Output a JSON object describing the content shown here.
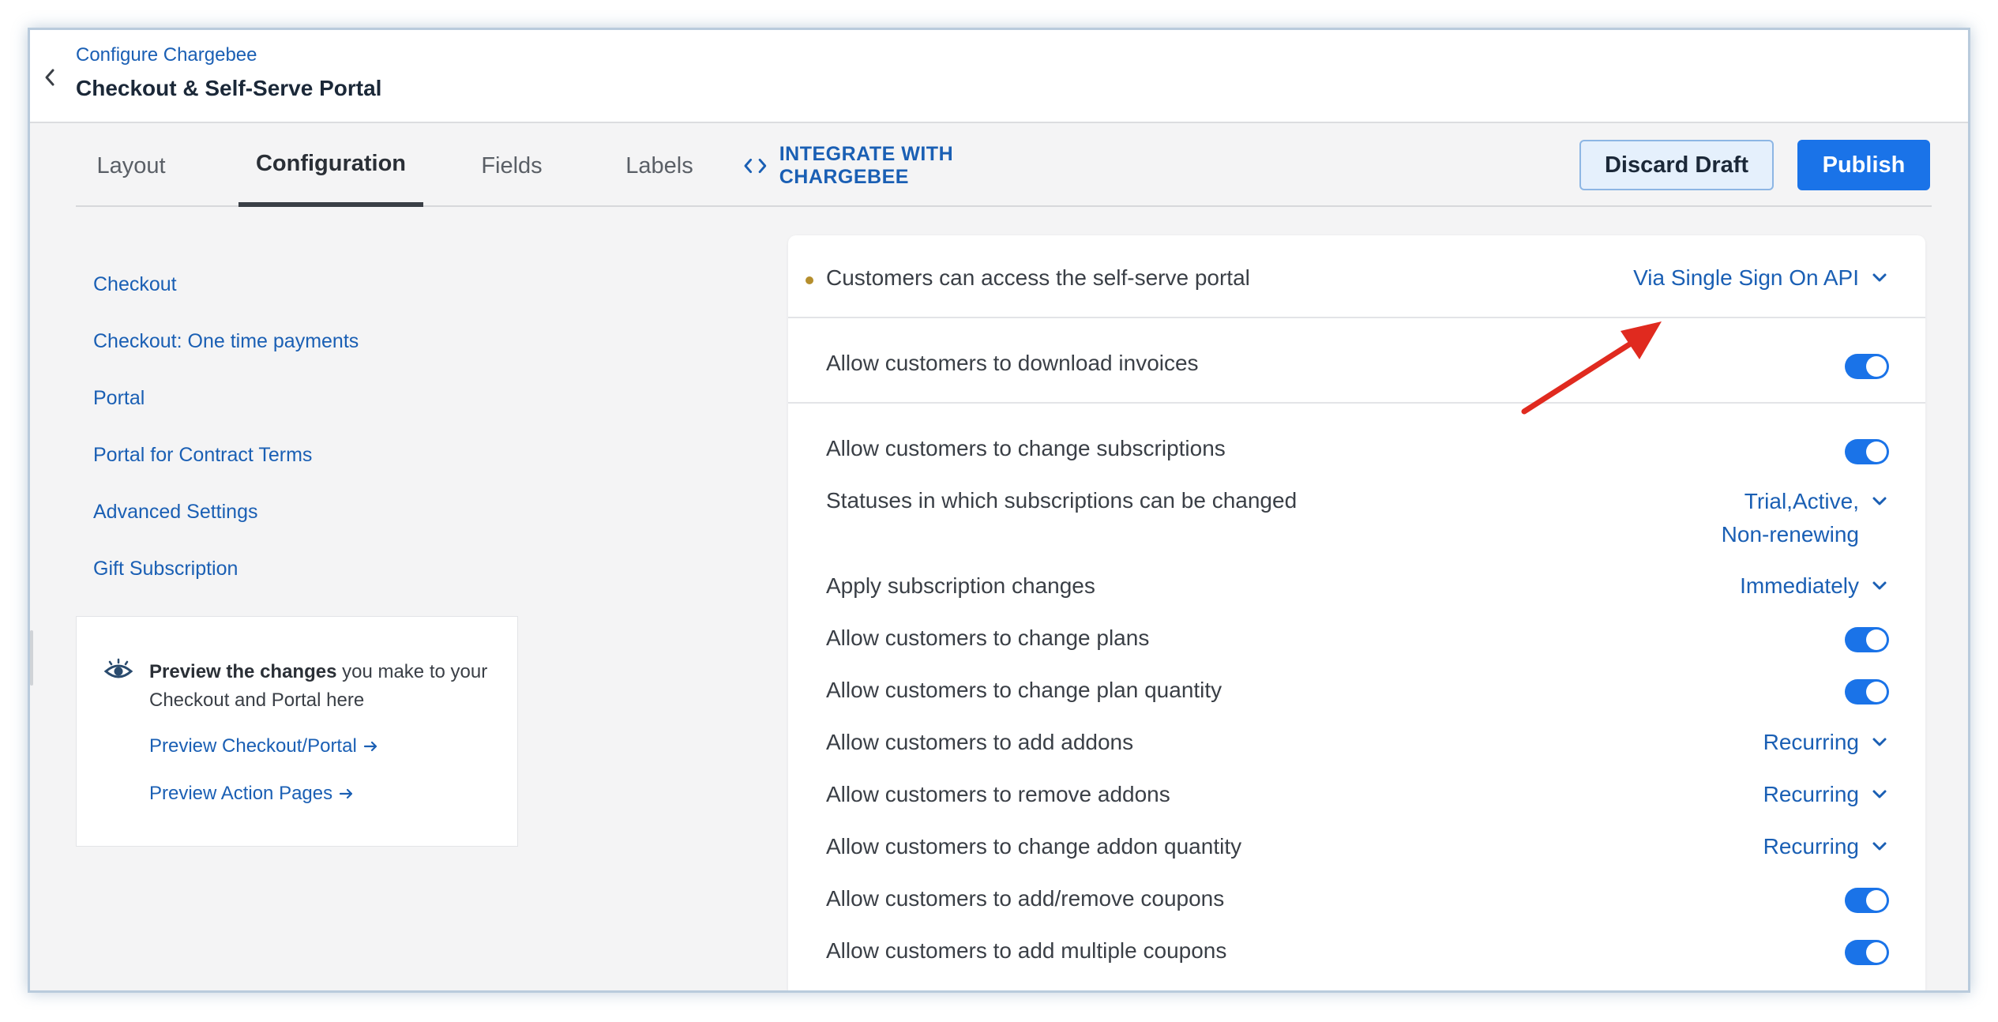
{
  "header": {
    "breadcrumb": "Configure Chargebee",
    "title": "Checkout & Self-Serve Portal"
  },
  "tabs": [
    {
      "label": "Layout",
      "active": false
    },
    {
      "label": "Configuration",
      "active": true
    },
    {
      "label": "Fields",
      "active": false
    },
    {
      "label": "Labels",
      "active": false
    },
    {
      "label": "INTEGRATE WITH CHARGEBEE",
      "active": false
    }
  ],
  "actions": {
    "discard_label": "Discard Draft",
    "publish_label": "Publish"
  },
  "sidebar": {
    "items": [
      {
        "label": "Checkout"
      },
      {
        "label": "Checkout: One time payments"
      },
      {
        "label": "Portal"
      },
      {
        "label": "Portal for Contract Terms"
      },
      {
        "label": "Advanced Settings"
      },
      {
        "label": "Gift Subscription"
      }
    ]
  },
  "preview": {
    "bold_text": "Preview the changes",
    "rest_text": " you make to your Checkout and Portal here",
    "link_checkout": "Preview Checkout/Portal",
    "link_action_pages": "Preview Action Pages"
  },
  "settings": {
    "portal_access": {
      "label": "Customers can access the self-serve portal",
      "value": "Via Single Sign On API"
    },
    "download_invoices": {
      "label": "Allow customers to download invoices",
      "enabled": true
    },
    "change_subscriptions": {
      "label": "Allow customers to change subscriptions",
      "enabled": true
    },
    "statuses": {
      "label": "Statuses in which subscriptions can be changed",
      "value_line1": "Trial,Active,",
      "value_line2": "Non-renewing"
    },
    "apply_changes": {
      "label": "Apply subscription changes",
      "value": "Immediately"
    },
    "change_plans": {
      "label": "Allow customers to change plans",
      "enabled": true
    },
    "change_plan_quantity": {
      "label": "Allow customers to change plan quantity",
      "enabled": true
    },
    "add_addons": {
      "label": "Allow customers to add addons",
      "value": "Recurring"
    },
    "remove_addons": {
      "label": "Allow customers to remove addons",
      "value": "Recurring"
    },
    "change_addon_quantity": {
      "label": "Allow customers to change addon quantity",
      "value": "Recurring"
    },
    "add_remove_coupons": {
      "label": "Allow customers to add/remove coupons",
      "enabled": true
    },
    "multiple_coupons": {
      "label": "Allow customers to add multiple coupons",
      "enabled": true
    }
  },
  "colors": {
    "accent": "#1a5fb4",
    "primary_button": "#1a73e8",
    "annotation_arrow": "#e02a1f"
  },
  "icons": {
    "back": "chevron-left-icon",
    "integrate": "code-icon",
    "preview": "eye-icon",
    "link_arrow": "arrow-right-icon",
    "dropdown": "chevron-down-icon"
  }
}
